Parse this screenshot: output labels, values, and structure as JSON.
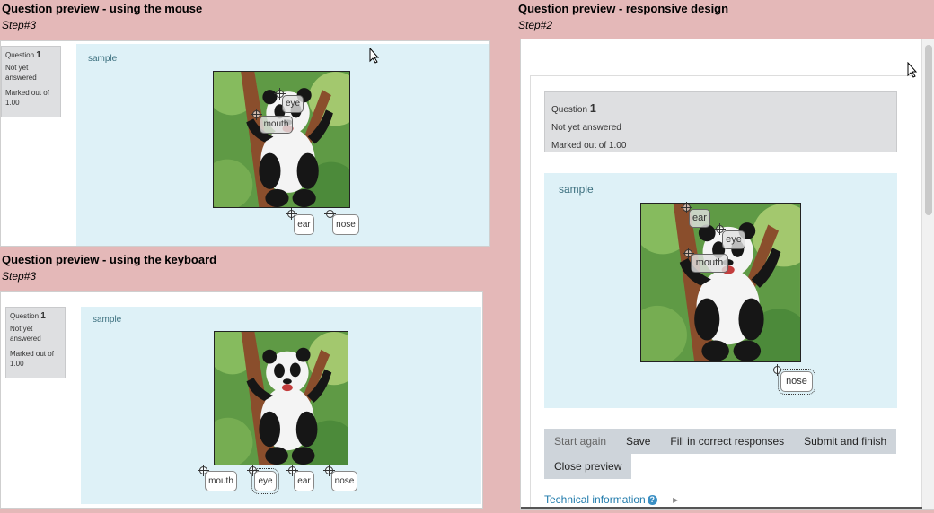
{
  "colors": {
    "background": "#e4b8b8",
    "dropzone": "#def1f7",
    "info_box": "#dedfe1",
    "button": "#ced4da",
    "link": "#1f7aab"
  },
  "panels": {
    "mouse": {
      "title": "Question preview - using the mouse",
      "step": "Step#3",
      "info": {
        "question_label": "Question",
        "question_number": "1",
        "status": "Not yet answered",
        "marks": "Marked out of 1.00"
      },
      "sample": "sample",
      "placed_labels": [
        "eye",
        "mouth"
      ],
      "tray_labels": [
        "ear",
        "nose"
      ]
    },
    "keyboard": {
      "title": "Question preview - using the keyboard",
      "step": "Step#3",
      "info": {
        "question_label": "Question",
        "question_number": "1",
        "status": "Not yet answered",
        "marks": "Marked out of 1.00"
      },
      "sample": "sample",
      "tray_labels": [
        "mouth",
        "eye",
        "ear",
        "nose"
      ]
    },
    "responsive": {
      "title": "Question preview - responsive design",
      "step": "Step#2",
      "info": {
        "question_label": "Question",
        "question_number": "1",
        "status": "Not yet answered",
        "marks": "Marked out of 1.00"
      },
      "sample": "sample",
      "placed_labels": [
        "ear",
        "eye",
        "mouth"
      ],
      "tray_labels": [
        "nose"
      ],
      "buttons": [
        "Start again",
        "Save",
        "Fill in correct responses",
        "Submit and finish",
        "Close preview"
      ],
      "technical_info": "Technical information",
      "help_icon": "?",
      "expand_icon": "▸"
    }
  }
}
